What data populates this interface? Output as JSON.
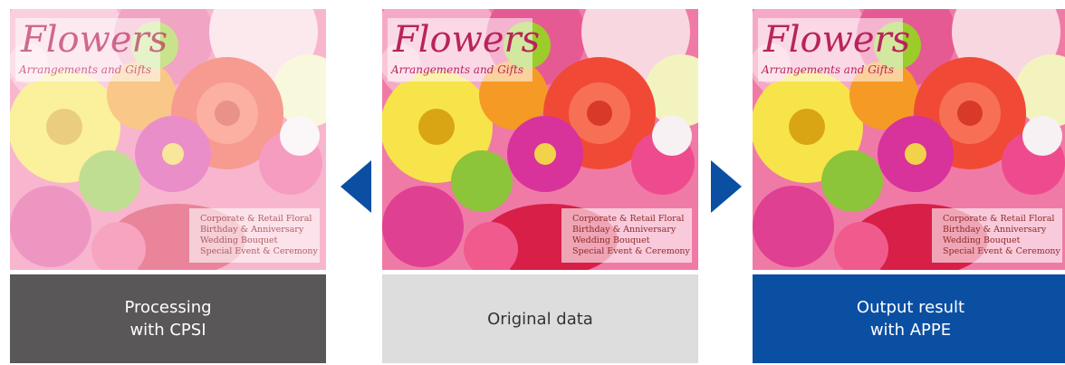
{
  "flyer": {
    "title": "Flowers",
    "subtitle": "Arrangements and Gifts",
    "services": [
      "Corporate & Retail Floral",
      "Birthday & Anniversary",
      "Wedding Bouquet",
      "Special Event & Ceremony"
    ]
  },
  "panels": {
    "left": {
      "caption_line1": "Processing",
      "caption_line2": "with CPSI"
    },
    "center": {
      "caption_line1": "Original data"
    },
    "right": {
      "caption_line1": "Output result",
      "caption_line2": "with APPE"
    }
  },
  "icons": {
    "left_arrow": "triangle-left-icon",
    "right_arrow": "triangle-right-icon"
  },
  "colors": {
    "caption_dark": "#595757",
    "caption_light": "#dddddd",
    "caption_blue": "#0b4fa3",
    "arrow": "#0b4fa3",
    "title_pink": "#b8245a"
  }
}
